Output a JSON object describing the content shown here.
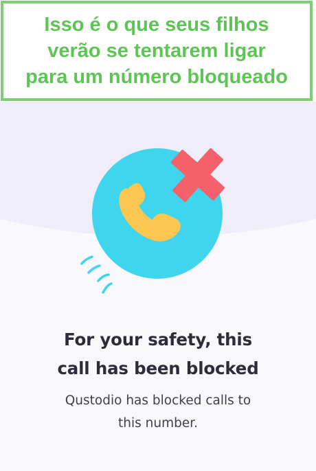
{
  "caption": {
    "lines": [
      "Isso é o que seus filhos",
      "verão se tentarem ligar",
      "para um número bloqueado"
    ],
    "color": "#5ec455",
    "border_color": "#7fcd77"
  },
  "screen": {
    "illustration": {
      "icons": [
        "phone-icon",
        "block-x-icon",
        "motion-lines-icon"
      ],
      "colors": {
        "circle": "#3fd5ec",
        "handset": "#fbc751",
        "cross": "#f5606a",
        "motion": "#3fd5ec"
      }
    },
    "title_lines": [
      "For your safety, this",
      "call has been blocked"
    ],
    "description_lines": [
      "Qustodio has blocked calls to",
      "this number."
    ],
    "background": "#f9f8fd",
    "dome_color": "#efedf8"
  }
}
